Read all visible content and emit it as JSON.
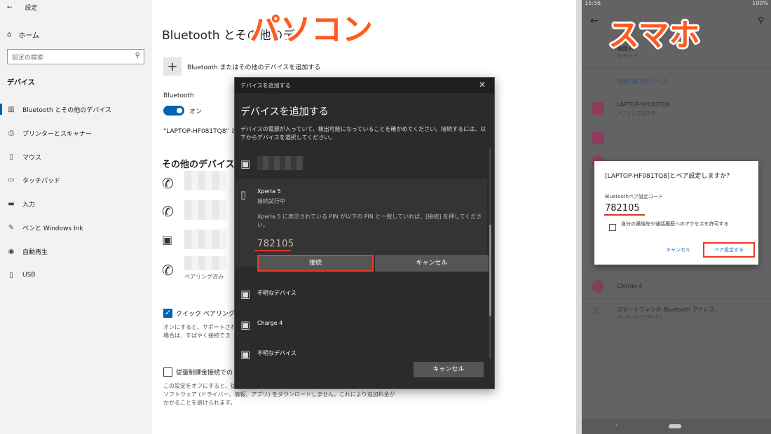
{
  "labels": {
    "pc": "パソコン",
    "phone": "スマホ"
  },
  "pc": {
    "sidebar": {
      "back_icon": "back-arrow-icon",
      "title": "設定",
      "home": "ホーム",
      "search_placeholder": "設定の検索",
      "section": "デバイス",
      "items": [
        {
          "label": "Bluetooth とその他のデバイス",
          "icon": "bluetooth-icon",
          "active": true
        },
        {
          "label": "プリンターとスキャナー",
          "icon": "printer-icon"
        },
        {
          "label": "マウス",
          "icon": "mouse-icon"
        },
        {
          "label": "タッチパッド",
          "icon": "touchpad-icon"
        },
        {
          "label": "入力",
          "icon": "keyboard-icon"
        },
        {
          "label": "ペンと Windows Ink",
          "icon": "pen-icon"
        },
        {
          "label": "自動再生",
          "icon": "autoplay-icon"
        },
        {
          "label": "USB",
          "icon": "usb-icon"
        }
      ]
    },
    "content": {
      "title": "Bluetooth とその他のデ",
      "add_device": "Bluetooth またはその他のデバイスを追加する",
      "bluetooth_label": "Bluetooth",
      "toggle_state": "オン",
      "discoverable": "\"LAPTOP-HF081TQ8\" と",
      "other_devices": "その他のデバイス",
      "paired": "ペアリング済み",
      "quick_pair": "クイック ペアリングを使",
      "quick_note": [
        "オンにすると、サポートされて",
        "場合は、すばやく接続でき"
      ],
      "metered": "従量制課金接続での",
      "metered_note": [
        "この設定をオフにすると、従",
        "ソフトウェア (ドライバー、情報、アプリ) をダウンロードしません。これにより追加料金が",
        "かかることを避けられます。"
      ]
    },
    "dialog": {
      "window_title": "デバイスを追加する",
      "heading": "デバイスを追加する",
      "description": "デバイスの電源が入っていて、検出可能になっていることを確かめてください。接続するには、以下からデバイスを選択してください。",
      "selected": {
        "name": "Xperia 5",
        "status": "接続試行中",
        "instruction": "Xperia 5 に表示されている PIN が以下の PIN と一致していれば、[接続] を押してください。",
        "pin": "782105",
        "connect": "接続",
        "cancel": "キャンセル"
      },
      "devices": [
        "不明なデバイス",
        "Charge 4",
        "不明なデバイス"
      ],
      "cancel": "キャンセル"
    }
  },
  "phone": {
    "status_time": "15:56",
    "battery": "100%",
    "device_name_label": "機器名",
    "device_name": "Xperia 5",
    "available_devices": "使用可能なデバイス",
    "list": [
      {
        "name": "LAPTOP-HF081TQ8",
        "sub": "ペアとして設定中..."
      },
      {
        "name": "Charge 4"
      }
    ],
    "bt_address_label": "スマートフォンの Bluetooth アドレス:",
    "bt_address": "38:78:62:F3:F0:C8",
    "dialog": {
      "title": "[LAPTOP-HF081TQ8]とペア設定しますか？",
      "code_label": "Bluetoothペア設定コード",
      "pin": "782105",
      "checkbox_label": "自分の連絡先や通話履歴へのアクセスを許可する",
      "cancel": "キャンセル",
      "ok": "ペア設定する"
    }
  },
  "colors": {
    "accent": "#0063b1",
    "highlight": "#e63b2a",
    "label_orange": "#ff5a1f"
  }
}
